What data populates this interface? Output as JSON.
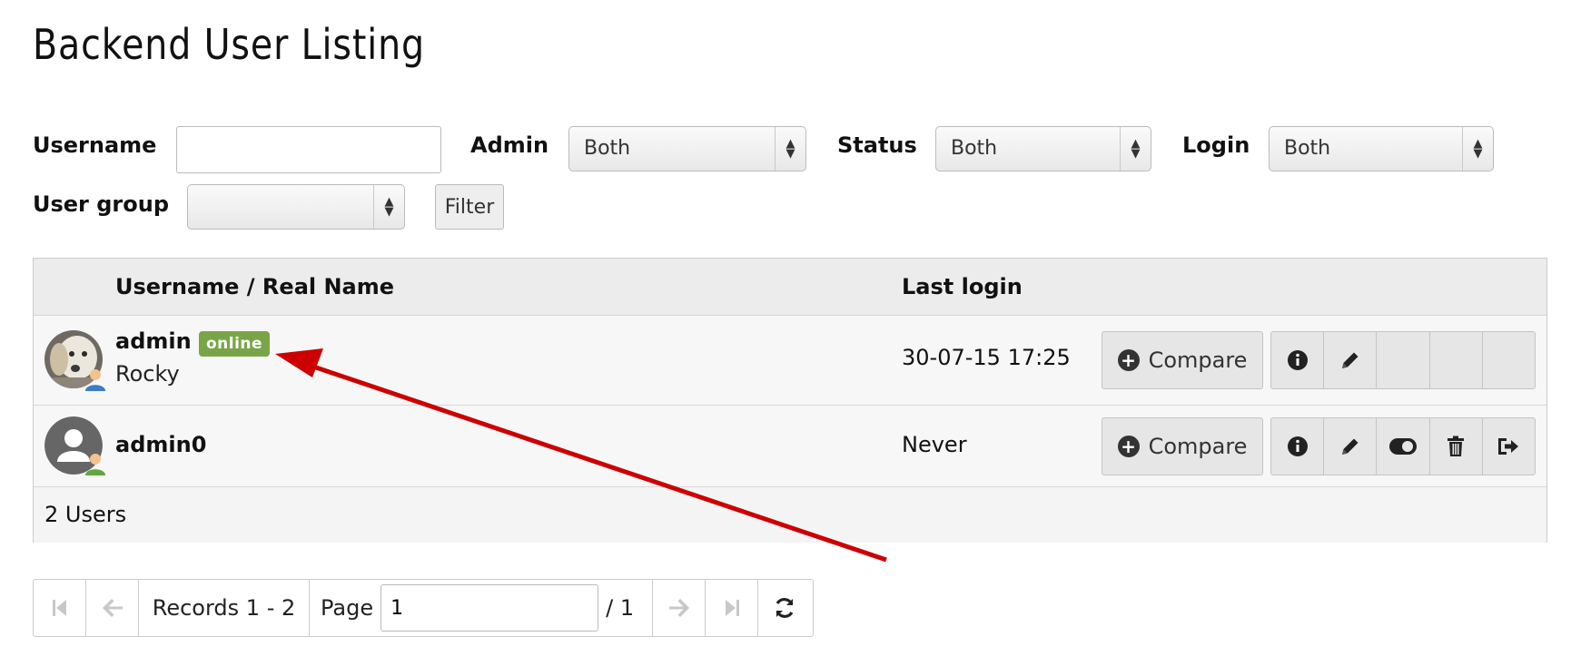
{
  "page": {
    "title": "Backend User Listing"
  },
  "filters": {
    "username_label": "Username",
    "username_value": "",
    "admin_label": "Admin",
    "admin_value": "Both",
    "status_label": "Status",
    "status_value": "Both",
    "login_label": "Login",
    "login_value": "Both",
    "usergroup_label": "User group",
    "usergroup_value": "",
    "filter_button": "Filter"
  },
  "table": {
    "columns": [
      "Username / Real Name",
      "Last login"
    ],
    "rows": [
      {
        "username": "admin",
        "badge": "online",
        "real_name": "Rocky",
        "last_login": "30-07-15 17:25",
        "compare_label": "Compare"
      },
      {
        "username": "admin0",
        "badge": "",
        "real_name": "",
        "last_login": "Never",
        "compare_label": "Compare"
      }
    ],
    "footer": "2 Users"
  },
  "pagination": {
    "records": "Records 1 - 2",
    "page_label": "Page",
    "page_value": "1",
    "total": "/ 1"
  },
  "colors": {
    "badge_online": "#79a548",
    "annotation_arrow": "#cc0000"
  },
  "icons": [
    "first-page-icon",
    "previous-page-icon",
    "next-page-icon",
    "last-page-icon",
    "refresh-icon",
    "info-icon",
    "pencil-icon",
    "toggle-icon",
    "trash-icon",
    "logout-icon",
    "plus-circle-icon"
  ]
}
